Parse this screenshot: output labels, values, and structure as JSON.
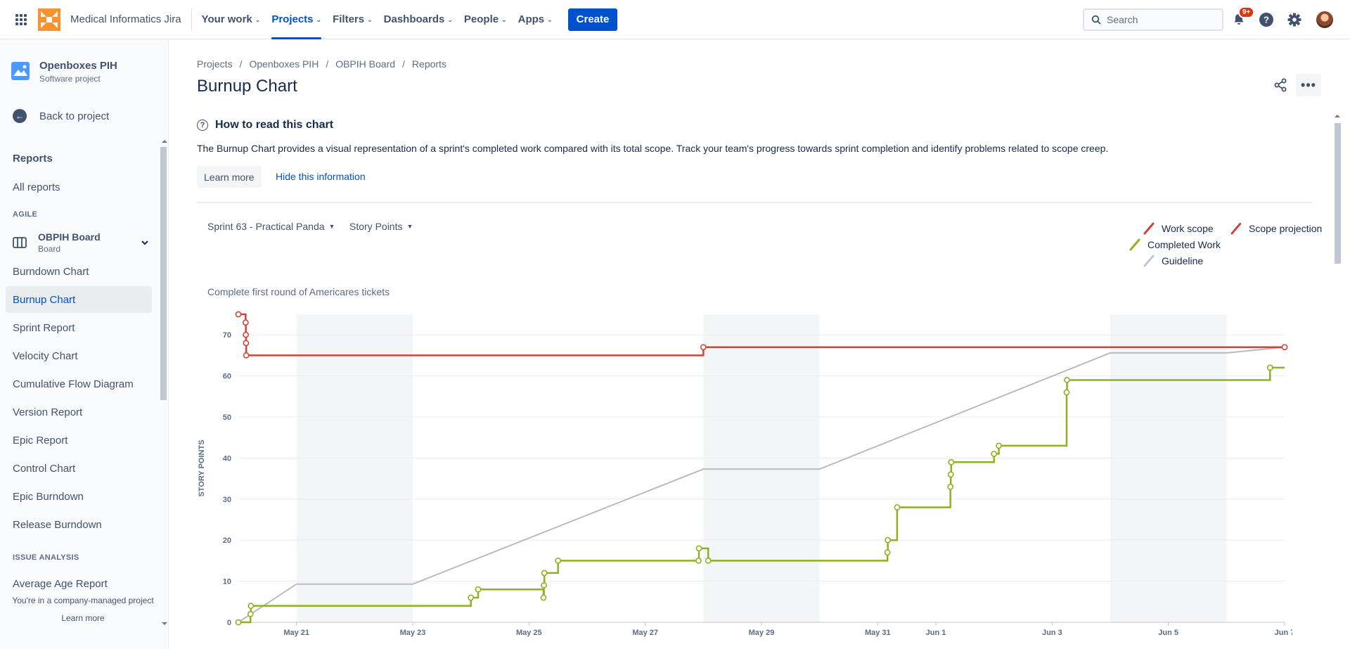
{
  "app": {
    "site_name": "Medical Informatics Jira",
    "nav": [
      {
        "label": "Your work"
      },
      {
        "label": "Projects"
      },
      {
        "label": "Filters"
      },
      {
        "label": "Dashboards"
      },
      {
        "label": "People"
      },
      {
        "label": "Apps"
      }
    ],
    "create_label": "Create",
    "search_placeholder": "Search",
    "notification_count": "9+",
    "accent_color": "#0052cc"
  },
  "sidebar": {
    "project_name": "Openboxes PIH",
    "project_type": "Software project",
    "back_label": "Back to project",
    "reports_heading": "Reports",
    "all_reports": "All reports",
    "agile_group": "AGILE",
    "board_name": "OBPIH Board",
    "board_type": "Board",
    "reports": [
      {
        "label": "Burndown Chart"
      },
      {
        "label": "Burnup Chart"
      },
      {
        "label": "Sprint Report"
      },
      {
        "label": "Velocity Chart"
      },
      {
        "label": "Cumulative Flow Diagram"
      },
      {
        "label": "Version Report"
      },
      {
        "label": "Epic Report"
      },
      {
        "label": "Control Chart"
      },
      {
        "label": "Epic Burndown"
      },
      {
        "label": "Release Burndown"
      }
    ],
    "issue_group": "ISSUE ANALYSIS",
    "issue_reports": [
      {
        "label": "Average Age Report"
      }
    ],
    "footer_text": "You're in a company-managed project",
    "footer_link": "Learn more"
  },
  "main": {
    "breadcrumbs": [
      "Projects",
      "Openboxes PIH",
      "OBPIH Board",
      "Reports"
    ],
    "title": "Burnup Chart",
    "info_title": "How to read this chart",
    "info_text": "The Burnup Chart provides a visual representation of a sprint's completed work compared with its total scope. Track your team's progress towards sprint completion and identify problems related to scope creep.",
    "learn_more": "Learn more",
    "hide_info": "Hide this information",
    "sprint_select": "Sprint 63 - Practical Panda",
    "estimate_select": "Story Points",
    "sprint_goal": "Complete first round of Americares tickets"
  },
  "chart_data": {
    "type": "line",
    "title": "",
    "ylabel": "STORY POINTS",
    "ylim": [
      0,
      75
    ],
    "y_ticks": [
      0,
      10,
      20,
      30,
      40,
      50,
      60,
      70
    ],
    "x_range": [
      "2023-05-20",
      "2023-06-07"
    ],
    "x_ticks": [
      "May 21",
      "May 23",
      "May 25",
      "May 27",
      "May 29",
      "May 31",
      "Jun 1",
      "Jun 3",
      "Jun 5",
      "Jun 7"
    ],
    "non_working_days": [
      [
        "2023-05-21",
        "2023-05-23"
      ],
      [
        "2023-05-28",
        "2023-05-30"
      ],
      [
        "2023-06-04",
        "2023-06-06"
      ]
    ],
    "grid": true,
    "legend_position": "top-right",
    "legend": [
      "Work scope",
      "Scope projection",
      "Completed Work",
      "Guideline"
    ],
    "series": [
      {
        "name": "Work scope",
        "color": "#d04437",
        "step": true,
        "points": [
          [
            "2023-05-20T00:00",
            75
          ],
          [
            "2023-05-20T03:00",
            73
          ],
          [
            "2023-05-20T03:05",
            70
          ],
          [
            "2023-05-20T03:10",
            68
          ],
          [
            "2023-05-20T03:15",
            65
          ],
          [
            "2023-05-28T00:00",
            67
          ],
          [
            "2023-06-07T00:00",
            67
          ]
        ]
      },
      {
        "name": "Completed Work",
        "color": "#8eb021",
        "step": true,
        "points": [
          [
            "2023-05-20T00:00",
            0
          ],
          [
            "2023-05-20T05:00",
            2
          ],
          [
            "2023-05-20T05:10",
            4
          ],
          [
            "2023-05-24T00:00",
            6
          ],
          [
            "2023-05-24T03:00",
            8
          ],
          [
            "2023-05-25T06:00",
            6
          ],
          [
            "2023-05-25T06:10",
            9
          ],
          [
            "2023-05-25T06:20",
            12
          ],
          [
            "2023-05-25T12:00",
            15
          ],
          [
            "2023-05-27T22:00",
            15
          ],
          [
            "2023-05-27T22:10",
            18
          ],
          [
            "2023-05-28T02:00",
            15
          ],
          [
            "2023-05-31T04:00",
            17
          ],
          [
            "2023-05-31T04:10",
            20
          ],
          [
            "2023-05-31T08:00",
            28
          ],
          [
            "2023-06-01T06:00",
            33
          ],
          [
            "2023-06-01T06:10",
            36
          ],
          [
            "2023-06-01T06:20",
            39
          ],
          [
            "2023-06-02T00:00",
            41
          ],
          [
            "2023-06-02T02:00",
            43
          ],
          [
            "2023-06-03T06:00",
            56
          ],
          [
            "2023-06-03T06:10",
            59
          ],
          [
            "2023-06-06T18:00",
            62
          ]
        ]
      },
      {
        "name": "Guideline",
        "color": "#bbbbbb",
        "step": false,
        "points": [
          [
            "2023-05-20",
            0
          ],
          [
            "2023-05-21",
            9.3
          ],
          [
            "2023-05-23",
            9.3
          ],
          [
            "2023-05-28",
            37.3
          ],
          [
            "2023-05-30",
            37.3
          ],
          [
            "2023-06-04",
            65.6
          ],
          [
            "2023-06-06",
            65.6
          ],
          [
            "2023-06-07",
            67
          ]
        ]
      },
      {
        "name": "Scope projection",
        "color": "#d04437",
        "dashed": true,
        "points": []
      }
    ]
  }
}
